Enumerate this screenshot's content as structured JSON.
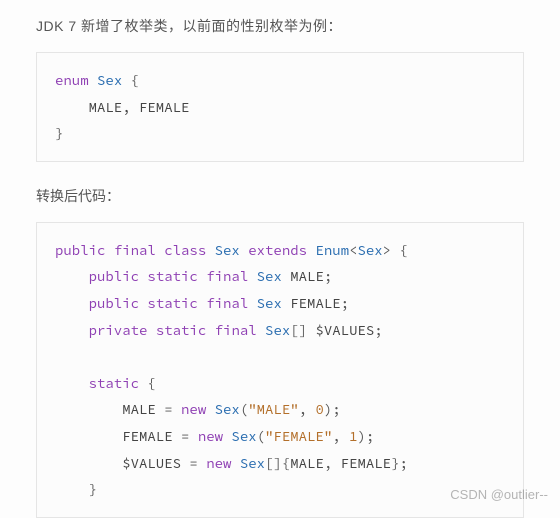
{
  "doc": {
    "intro": "JDK 7 新增了枚举类，以前面的性别枚举为例：",
    "after_label": "转换后代码：",
    "watermark": "CSDN @outlier--"
  },
  "code1": {
    "kw_enum": "enum",
    "cls_sex": "Sex",
    "open": "{",
    "body": "    MALE, FEMALE",
    "close": "}"
  },
  "code2": {
    "l1": {
      "kw1": "public",
      "kw2": "final",
      "kw3": "class",
      "cls": "Sex",
      "kw4": "extends",
      "sup": "Enum",
      "lt": "<",
      "param": "Sex",
      "gt": ">",
      "open": "{"
    },
    "l2": {
      "kw1": "public",
      "kw2": "static",
      "kw3": "final",
      "type": "Sex",
      "name": "MALE",
      "semi": ";"
    },
    "l3": {
      "kw1": "public",
      "kw2": "static",
      "kw3": "final",
      "type": "Sex",
      "name": "FEMALE",
      "semi": ";"
    },
    "l4": {
      "kw1": "private",
      "kw2": "static",
      "kw3": "final",
      "type": "Sex",
      "arr": "[]",
      "name": "$VALUES",
      "semi": ";"
    },
    "l5": {
      "kw": "static",
      "open": "{"
    },
    "l6": {
      "lhs": "MALE",
      "eq": " = ",
      "kw": "new",
      "cls": "Sex",
      "open": "(",
      "str": "\"MALE\"",
      "comma": ", ",
      "num": "0",
      "close": ");"
    },
    "l7": {
      "lhs": "FEMALE",
      "eq": " = ",
      "kw": "new",
      "cls": "Sex",
      "open": "(",
      "str": "\"FEMALE\"",
      "comma": ", ",
      "num": "1",
      "close": ");"
    },
    "l8": {
      "lhs": "$VALUES",
      "eq": " = ",
      "kw": "new",
      "cls": "Sex",
      "arr": "[]",
      "open": "{",
      "a": "MALE",
      "comma": ", ",
      "b": "FEMALE",
      "close": "};"
    },
    "l9": {
      "close": "}"
    }
  }
}
